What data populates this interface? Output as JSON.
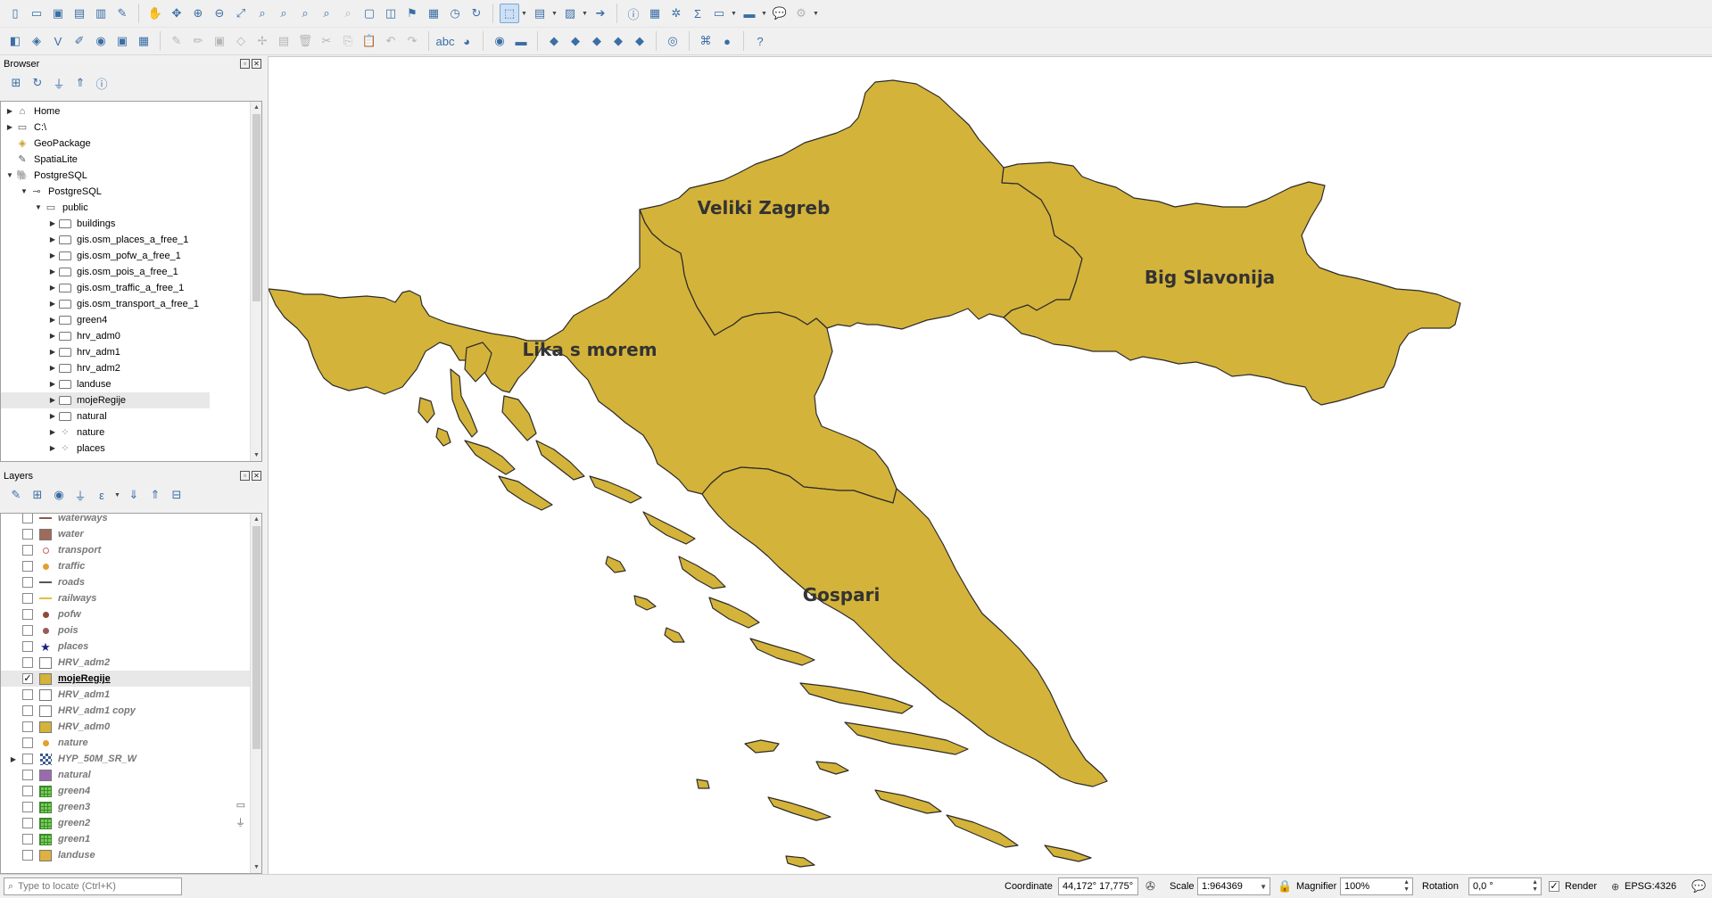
{
  "toolbar_top_icons": [
    "new-project-icon",
    "open-project-icon",
    "save-project-icon",
    "save-as-icon",
    "print-layout-icon",
    "style-manager-icon",
    "pan-icon",
    "pan-to-selection-icon",
    "zoom-in-icon",
    "zoom-out-icon",
    "zoom-full-icon",
    "zoom-selection-icon",
    "zoom-layer-icon",
    "zoom-native-icon",
    "zoom-last-icon",
    "zoom-next-icon",
    "new-map-view-icon",
    "new-3d-view-icon",
    "bookmark-icon",
    "show-bookmarks-icon",
    "temporal-icon",
    "refresh-icon",
    "select-features-icon",
    "select-by-value-icon",
    "deselect-icon",
    "identify-icon",
    "attribute-table-icon",
    "field-calculator-icon",
    "statistics-icon",
    "measure-icon",
    "annotation-icon",
    "settings-icon"
  ],
  "browser": {
    "title": "Browser",
    "items": [
      {
        "label": "Home",
        "icon": "home-icon",
        "depth": 0,
        "expand": "collapsed"
      },
      {
        "label": "C:\\",
        "icon": "drive-icon",
        "depth": 0,
        "expand": "collapsed"
      },
      {
        "label": "GeoPackage",
        "icon": "geopackage-icon",
        "depth": 0,
        "expand": "none"
      },
      {
        "label": "SpatiaLite",
        "icon": "spatialite-icon",
        "depth": 0,
        "expand": "none"
      },
      {
        "label": "PostgreSQL",
        "icon": "postgresql-icon",
        "depth": 0,
        "expand": "expanded"
      },
      {
        "label": "PostgreSQL",
        "icon": "connection-icon",
        "depth": 1,
        "expand": "expanded"
      },
      {
        "label": "public",
        "icon": "schema-icon",
        "depth": 2,
        "expand": "expanded"
      },
      {
        "label": "buildings",
        "icon": "polygon-layer-icon",
        "depth": 3,
        "expand": "collapsed"
      },
      {
        "label": "gis.osm_places_a_free_1",
        "icon": "polygon-layer-icon",
        "depth": 3,
        "expand": "collapsed"
      },
      {
        "label": "gis.osm_pofw_a_free_1",
        "icon": "polygon-layer-icon",
        "depth": 3,
        "expand": "collapsed"
      },
      {
        "label": "gis.osm_pois_a_free_1",
        "icon": "polygon-layer-icon",
        "depth": 3,
        "expand": "collapsed"
      },
      {
        "label": "gis.osm_traffic_a_free_1",
        "icon": "polygon-layer-icon",
        "depth": 3,
        "expand": "collapsed"
      },
      {
        "label": "gis.osm_transport_a_free_1",
        "icon": "polygon-layer-icon",
        "depth": 3,
        "expand": "collapsed"
      },
      {
        "label": "green4",
        "icon": "polygon-layer-icon",
        "depth": 3,
        "expand": "collapsed"
      },
      {
        "label": "hrv_adm0",
        "icon": "polygon-layer-icon",
        "depth": 3,
        "expand": "collapsed"
      },
      {
        "label": "hrv_adm1",
        "icon": "polygon-layer-icon",
        "depth": 3,
        "expand": "collapsed"
      },
      {
        "label": "hrv_adm2",
        "icon": "polygon-layer-icon",
        "depth": 3,
        "expand": "collapsed"
      },
      {
        "label": "landuse",
        "icon": "polygon-layer-icon",
        "depth": 3,
        "expand": "collapsed"
      },
      {
        "label": "mojeRegije",
        "icon": "polygon-layer-icon",
        "depth": 3,
        "expand": "collapsed",
        "selected": true
      },
      {
        "label": "natural",
        "icon": "polygon-layer-icon",
        "depth": 3,
        "expand": "collapsed"
      },
      {
        "label": "nature",
        "icon": "point-layer-icon",
        "depth": 3,
        "expand": "collapsed"
      },
      {
        "label": "places",
        "icon": "point-layer-icon",
        "depth": 3,
        "expand": "collapsed"
      }
    ]
  },
  "layers": {
    "title": "Layers",
    "items": [
      {
        "label": "waterways",
        "symbol": "line",
        "color": "#8b5a4a",
        "checked": false
      },
      {
        "label": "water",
        "symbol": "fill",
        "color": "#a06a5a",
        "checked": false
      },
      {
        "label": "transport",
        "symbol": "ring",
        "color": "#c86464",
        "checked": false
      },
      {
        "label": "traffic",
        "symbol": "dot",
        "color": "#e0a030",
        "checked": false
      },
      {
        "label": "roads",
        "symbol": "line",
        "color": "#555555",
        "checked": false
      },
      {
        "label": "railways",
        "symbol": "line",
        "color": "#e0c040",
        "checked": false
      },
      {
        "label": "pofw",
        "symbol": "dot",
        "color": "#8b4a3a",
        "checked": false
      },
      {
        "label": "pois",
        "symbol": "dot",
        "color": "#9a5a5a",
        "checked": false
      },
      {
        "label": "places",
        "symbol": "star",
        "color": "#1a237e",
        "checked": false
      },
      {
        "label": "HRV_adm2",
        "symbol": "fill",
        "color": "#ffffff",
        "checked": false
      },
      {
        "label": "mojeRegije",
        "symbol": "fill",
        "color": "#d4b33a",
        "checked": true,
        "selected": true
      },
      {
        "label": "HRV_adm1",
        "symbol": "fill",
        "color": "#ffffff",
        "checked": false
      },
      {
        "label": "HRV_adm1 copy",
        "symbol": "fill",
        "color": "#ffffff",
        "checked": false
      },
      {
        "label": "HRV_adm0",
        "symbol": "fill",
        "color": "#d4b33a",
        "checked": false
      },
      {
        "label": "nature",
        "symbol": "dot",
        "color": "#e0a030",
        "checked": false
      },
      {
        "label": "HYP_50M_SR_W",
        "symbol": "raster",
        "color": "#3a5a8a",
        "checked": false,
        "expand": true
      },
      {
        "label": "natural",
        "symbol": "fill",
        "color": "#9a6ab0",
        "checked": false
      },
      {
        "label": "green4",
        "symbol": "grid",
        "color": "#7acb5a",
        "checked": false
      },
      {
        "label": "green3",
        "symbol": "grid",
        "color": "#7acb5a",
        "checked": false
      },
      {
        "label": "green2",
        "symbol": "grid",
        "color": "#7acb5a",
        "checked": false
      },
      {
        "label": "green1",
        "symbol": "grid",
        "color": "#7acb5a",
        "checked": false
      },
      {
        "label": "landuse",
        "symbol": "fill",
        "color": "#e0b040",
        "checked": false
      }
    ]
  },
  "map": {
    "fill_color": "#d4b33a",
    "regions": [
      "Veliki Zagreb",
      "Big Slavonija",
      "Lika s morem",
      "Gospari"
    ]
  },
  "status": {
    "locate_placeholder": "Type to locate (Ctrl+K)",
    "coordinate_label": "Coordinate",
    "coordinate_value": "44,172° 17,775°",
    "scale_label": "Scale",
    "scale_value": "1:964369",
    "magnifier_label": "Magnifier",
    "magnifier_value": "100%",
    "rotation_label": "Rotation",
    "rotation_value": "0,0 °",
    "render_label": "Render",
    "render_checked": true,
    "crs_label": "EPSG:4326"
  }
}
